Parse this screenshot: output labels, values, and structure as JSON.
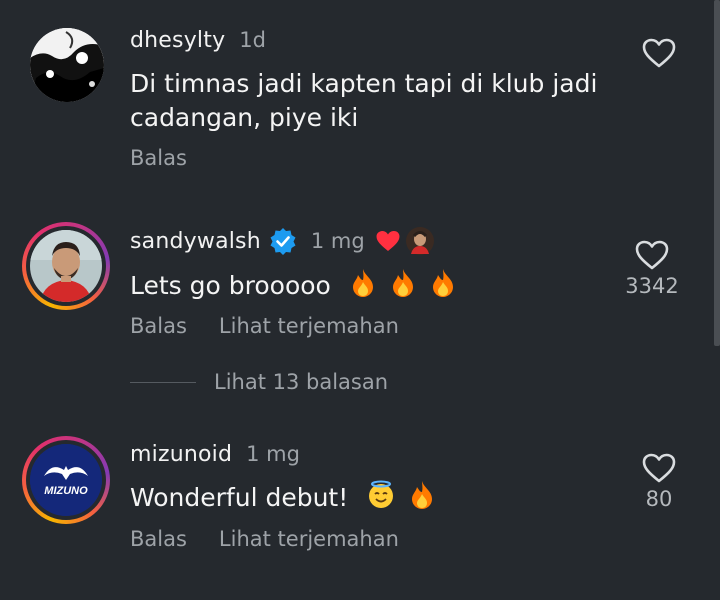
{
  "colors": {
    "background": "#25292e",
    "secondary_text": "#9ea3a8",
    "verified_blue": "#1d9bf0",
    "heart_red": "#ff3040",
    "flame": "#ff7a00"
  },
  "comments": [
    {
      "username": "dhesylty",
      "time": "1d",
      "text": "Di timnas jadi kapten tapi di klub jadi cadangan, piye iki",
      "reply_label": "Balas",
      "like_count": ""
    },
    {
      "username": "sandywalsh",
      "verified": true,
      "time": "1 mg",
      "creator_liked": true,
      "text": "Lets go brooooo",
      "emojis": [
        "fire",
        "fire",
        "fire"
      ],
      "reply_label": "Balas",
      "translate_label": "Lihat terjemahan",
      "like_count": "3342",
      "view_replies_label": "Lihat 13 balasan"
    },
    {
      "username": "mizunoid",
      "time": "1 mg",
      "text": "Wonderful debut!",
      "emojis": [
        "smiling-face-with-halo",
        "fire"
      ],
      "reply_label": "Balas",
      "translate_label": "Lihat terjemahan",
      "like_count": "80",
      "avatar_logo_text": "MIZUNO"
    }
  ]
}
